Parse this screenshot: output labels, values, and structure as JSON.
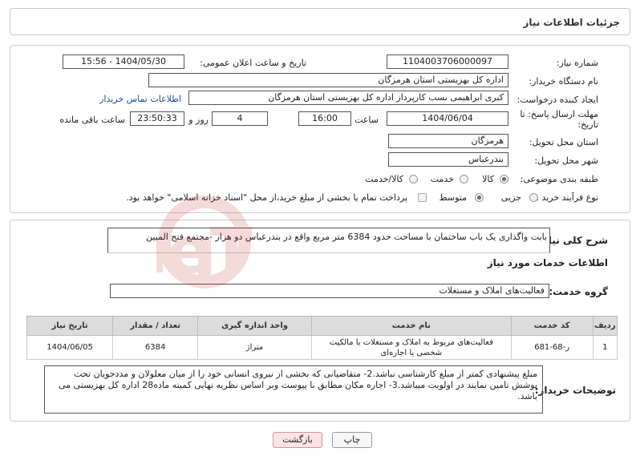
{
  "header": {
    "title": "جزئیات اطلاعات نیاز"
  },
  "form": {
    "need_number_label": "شماره نیاز:",
    "need_number": "1104003706000097",
    "announce_label": "تاریخ و ساعت اعلان عمومی:",
    "announce_value": "1404/05/30 - 15:56",
    "buyer_org_label": "نام دستگاه خریدار:",
    "buyer_org": "اداره کل بهزیستی استان هرمزگان",
    "creator_label": "ایجاد کننده درخواست:",
    "creator": "کبری  ابراهیمی نسب کارپرداز اداره کل بهزیستی استان هرمزگان",
    "contact_link": "اطلاعات تماس خریدار",
    "deadline_label": "مهلت ارسال پاسخ: تا تاریخ:",
    "deadline_date": "1404/06/04",
    "time_label": "ساعت",
    "deadline_time": "16:00",
    "days_value": "4",
    "days_label": "روز و",
    "remaining_time": "23:50:33",
    "remaining_label": "ساعت باقی مانده",
    "province_label": "استان محل تحویل:",
    "province": "هرمزگان",
    "city_label": "شهر محل تحویل:",
    "city": "بندرعباس",
    "category_label": "طبقه بندی موضوعی:",
    "category_options": [
      "کالا",
      "خدمت",
      "کالا/خدمت"
    ],
    "process_label": "نوع فرآیند خرید :",
    "process_options": [
      "جزیی",
      "متوسط"
    ],
    "payment_note": "پرداخت تمام یا بخشی از مبلغ خرید،از محل \"اسناد خزانه اسلامی\" خواهد بود."
  },
  "summary": {
    "label": "شرح کلی نیاز:",
    "text": "بابت واگذاری یک باب ساختمان با مساحت حدود 6384 متر مربع واقع در بندرعباس دو هزار -مجتمع فتح المبین"
  },
  "services": {
    "section_title": "اطلاعات خدمات مورد نیاز",
    "group_label": "گروه خدمت:",
    "group_value": "فعالیت‌های  املاک و مستغلات",
    "columns": [
      "ردیف",
      "کد خدمت",
      "نام خدمت",
      "واحد اندازه گیری",
      "تعداد / مقدار",
      "تاریخ نیاز"
    ],
    "rows": [
      {
        "row": "1",
        "code": "ر-68-681",
        "name": "فعالیت‌های مربوط به املاک و مستغلات با مالکیت شخصی یا اجاره‌ای",
        "unit": "متراژ",
        "qty": "6384",
        "date": "1404/06/05"
      }
    ]
  },
  "buyer_notes": {
    "label": "توضیحات خریدار:",
    "text": "مبلغ پیشنهادی کمتر از مبلغ کارشناسی نباشد.2- متقاضیانی که بخشی از نیروی انسانی خود را از میان معلولان و مددجویان تحت پوشش تامین نمایند در اولویت میباشد.3-  اجاره مکان  مطابق با پیوست وبر اساس نظریه نهایی کمیته ماده28 اداره کل بهزیستی می باشد."
  },
  "buttons": {
    "print": "چاپ",
    "back": "بازگشت"
  },
  "watermark": {
    "text": "AriaTender.neT"
  }
}
